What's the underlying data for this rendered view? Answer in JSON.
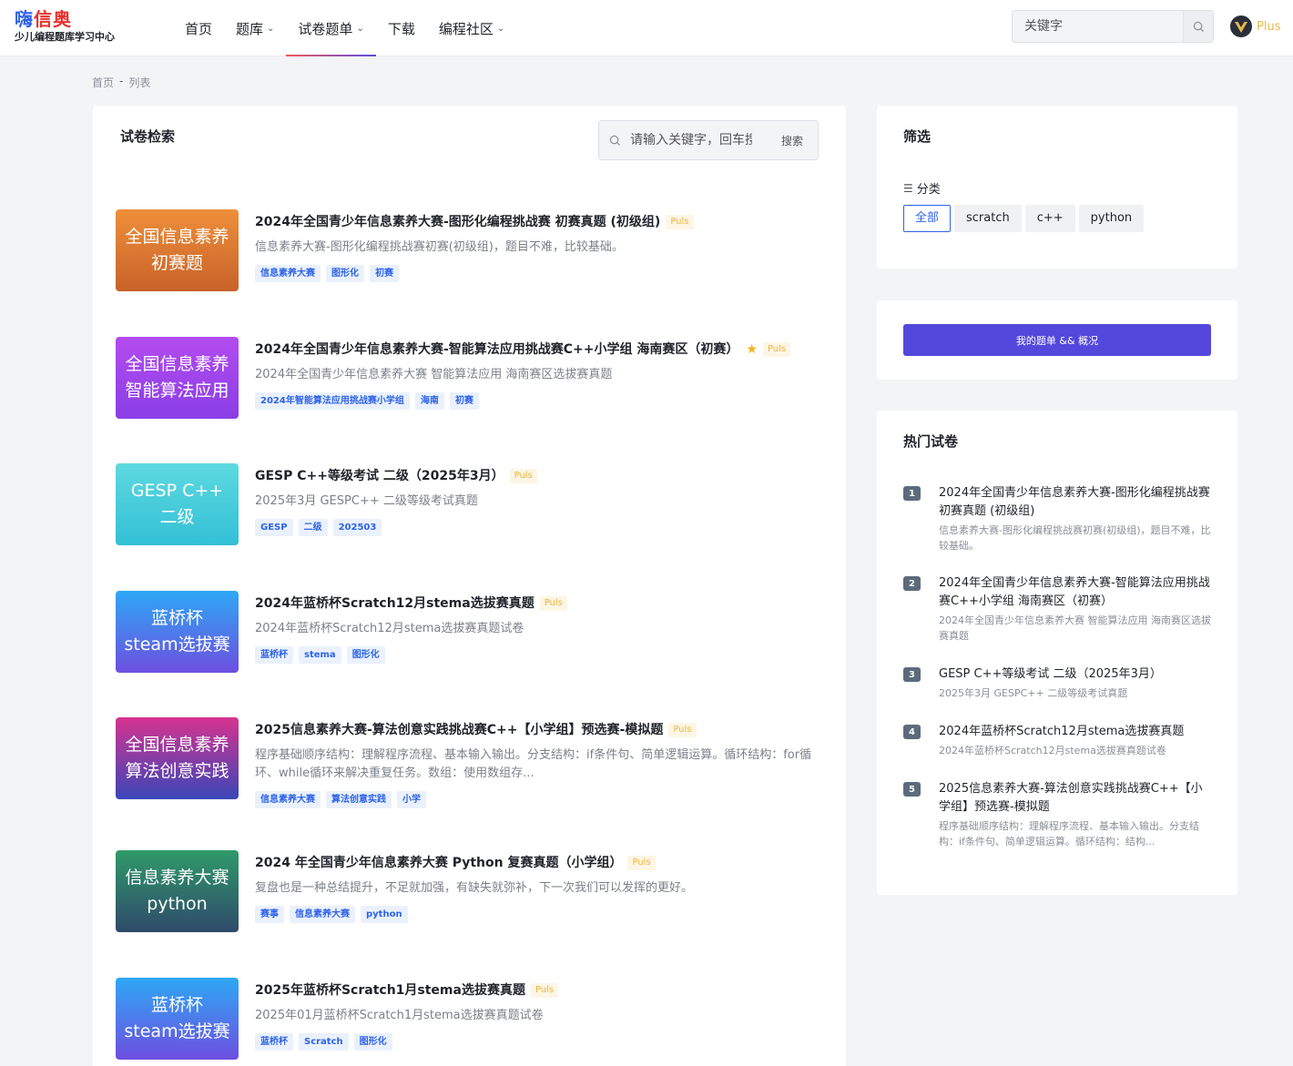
{
  "brand": {
    "part1": "嗨",
    "part2": "信奥",
    "subtitle": "少儿编程题库学习中心"
  },
  "nav": [
    {
      "label": "首页",
      "dropdown": false,
      "active": false
    },
    {
      "label": "题库",
      "dropdown": true,
      "active": false
    },
    {
      "label": "试卷题单",
      "dropdown": true,
      "active": true
    },
    {
      "label": "下载",
      "dropdown": false,
      "active": false
    },
    {
      "label": "编程社区",
      "dropdown": true,
      "active": false
    }
  ],
  "header": {
    "search_placeholder": "关键字",
    "plus_label": "Plus"
  },
  "breadcrumb": {
    "home": "首页",
    "sep": "-",
    "current": "列表"
  },
  "main": {
    "title": "试卷检索",
    "search_placeholder": "请输入关键字，回车搜",
    "search_button": "搜索",
    "puls_label": "Puls",
    "items": [
      {
        "thumb_lines": [
          "全国信息素养",
          "初赛题"
        ],
        "thumb_gradient": [
          "#ee8f3a",
          "#c8622a"
        ],
        "title": "2024年全国青少年信息素养大赛-图形化编程挑战赛 初赛真题 (初级组)",
        "star": false,
        "desc": "信息素养大赛-图形化编程挑战赛初赛(初级组)，题目不难，比较基础。",
        "tags": [
          "信息素养大赛",
          "图形化",
          "初赛"
        ]
      },
      {
        "thumb_lines": [
          "全国信息素养",
          "智能算法应用"
        ],
        "thumb_gradient": [
          "#b34cf0",
          "#8a3ee6"
        ],
        "title": "2024年全国青少年信息素养大赛-智能算法应用挑战赛C++小学组 海南赛区（初赛）",
        "star": true,
        "desc": "2024年全国青少年信息素养大赛 智能算法应用 海南赛区选拔赛真题",
        "tags": [
          "2024年智能算法应用挑战赛小学组",
          "海南",
          "初赛"
        ]
      },
      {
        "thumb_lines": [
          "GESP C++",
          "二级"
        ],
        "thumb_gradient": [
          "#5dd9e0",
          "#33c0d6"
        ],
        "title": "GESP C++等级考试 二级（2025年3月）",
        "star": false,
        "desc": "2025年3月 GESPC++ 二级等级考试真题",
        "tags": [
          "GESP",
          "二级",
          "202503"
        ]
      },
      {
        "thumb_lines": [
          "蓝桥杯",
          "steam选拔赛"
        ],
        "thumb_gradient": [
          "#2ea8f5",
          "#6d4fe0"
        ],
        "title": "2024年蓝桥杯Scratch12月stema选拔赛真题",
        "star": false,
        "desc": "2024年蓝桥杯Scratch12月stema选拔赛真题试卷",
        "tags": [
          "蓝桥杯",
          "stema",
          "图形化"
        ]
      },
      {
        "thumb_lines": [
          "全国信息素养",
          "算法创意实践"
        ],
        "thumb_gradient": [
          "#d6338f",
          "#3a46b8"
        ],
        "title": "2025信息素养大赛-算法创意实践挑战赛C++【小学组】预选赛-模拟题",
        "star": false,
        "desc": "程序基础顺序结构：理解程序流程、基本输入输出。分支结构：if条件句、简单逻辑运算。循环结构：for循环、while循环来解决重复任务。数组：使用数组存...",
        "tags": [
          "信息素养大赛",
          "算法创意实践",
          "小学"
        ]
      },
      {
        "thumb_lines": [
          "信息素养大赛",
          "python"
        ],
        "thumb_gradient": [
          "#2f9a6a",
          "#2f4a6a"
        ],
        "title": "2024 年全国青少年信息素养大赛 Python 复赛真题（小学组）",
        "star": false,
        "desc": "复盘也是一种总结提升，不足就加强，有缺失就弥补，下一次我们可以发挥的更好。",
        "tags": [
          "赛事",
          "信息素养大赛",
          "python"
        ]
      },
      {
        "thumb_lines": [
          "蓝桥杯",
          "steam选拔赛"
        ],
        "thumb_gradient": [
          "#2ea8f5",
          "#6d4fe0"
        ],
        "title": "2025年蓝桥杯Scratch1月stema选拔赛真题",
        "star": false,
        "desc": "2025年01月蓝桥杯Scratch1月stema选拔赛真题试卷",
        "tags": [
          "蓝桥杯",
          "Scratch",
          "图形化"
        ]
      }
    ]
  },
  "filter_panel": {
    "title": "筛选",
    "category_label": "分类",
    "options": [
      {
        "label": "全部",
        "active": true
      },
      {
        "label": "scratch",
        "active": false
      },
      {
        "label": "c++",
        "active": false
      },
      {
        "label": "python",
        "active": false
      }
    ]
  },
  "my_lists": {
    "button_label": "我的题单 && 概况"
  },
  "hot": {
    "title": "热门试卷",
    "items": [
      {
        "rank": "1",
        "title": "2024年全国青少年信息素养大赛-图形化编程挑战赛 初赛真题 (初级组)",
        "desc": "信息素养大赛-图形化编程挑战赛初赛(初级组)，题目不难，比较基础。"
      },
      {
        "rank": "2",
        "title": "2024年全国青少年信息素养大赛-智能算法应用挑战赛C++小学组 海南赛区（初赛）",
        "desc": "2024年全国青少年信息素养大赛 智能算法应用 海南赛区选拔赛真题"
      },
      {
        "rank": "3",
        "title": "GESP C++等级考试 二级（2025年3月）",
        "desc": "2025年3月 GESPC++ 二级等级考试真题"
      },
      {
        "rank": "4",
        "title": "2024年蓝桥杯Scratch12月stema选拔赛真题",
        "desc": "2024年蓝桥杯Scratch12月stema选拔赛真题试卷"
      },
      {
        "rank": "5",
        "title": "2025信息素养大赛-算法创意实践挑战赛C++【小学组】预选赛-模拟题",
        "desc": "程序基础顺序结构：理解程序流程、基本输入输出。分支结构：if条件句、简单逻辑运算。循环结构：结构..."
      }
    ]
  },
  "colors": {
    "accent": "#5448dc",
    "link_blue": "#2e63e8",
    "puls_gold": "#f0b23d"
  }
}
